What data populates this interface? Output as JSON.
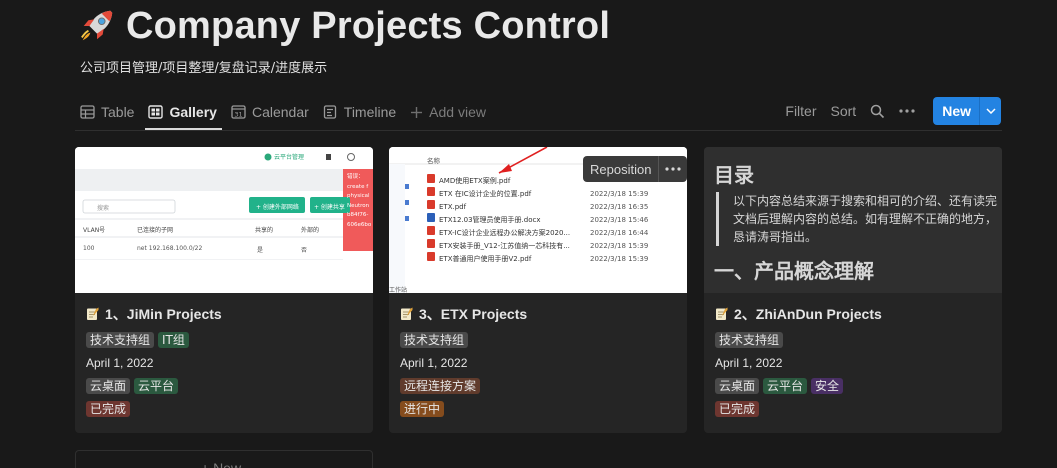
{
  "page": {
    "title": "Company Projects Control",
    "subtitle": "公司项目管理/项目整理/复盘记录/进度展示"
  },
  "tabs": [
    {
      "label": "Table",
      "icon": "table-icon"
    },
    {
      "label": "Gallery",
      "icon": "gallery-icon",
      "active": true
    },
    {
      "label": "Calendar",
      "icon": "calendar-icon"
    },
    {
      "label": "Timeline",
      "icon": "timeline-icon"
    },
    {
      "label": "Add view",
      "icon": "plus-icon"
    }
  ],
  "toolbar": {
    "filter_label": "Filter",
    "sort_label": "Sort",
    "new_label": "New"
  },
  "colors": {
    "background": "#191919",
    "card": "#252525",
    "accent": "#2383e2"
  },
  "cover_tools": {
    "reposition_label": "Reposition"
  },
  "cards": [
    {
      "title": "1、JiMin Projects",
      "groups": [
        {
          "text": "技术支持组",
          "color": "gray"
        },
        {
          "text": "IT组",
          "color": "green"
        }
      ],
      "date": "April 1, 2022",
      "products": [
        {
          "text": "云桌面",
          "color": "gray"
        },
        {
          "text": "云平台",
          "color": "green"
        }
      ],
      "status": {
        "text": "已完成",
        "color": "brown"
      },
      "cover": {
        "header_label": "云平台管理",
        "search_placeholder": "搜索",
        "btn1": "+ 创建外部网络",
        "btn2": "+ 创建共享",
        "columns": [
          "VLAN号",
          "已连接的子网",
          "共享的",
          "外部的"
        ],
        "row": [
          "100",
          "net 192.168.100.0/22",
          "是",
          "否"
        ],
        "error_lines": [
          "错误：",
          "create f",
          "physical",
          "Neutron",
          "b84f76-",
          "606e6bo"
        ]
      }
    },
    {
      "title": "3、ETX Projects",
      "groups": [
        {
          "text": "技术支持组",
          "color": "gray"
        }
      ],
      "date": "April 1, 2022",
      "products": [
        {
          "text": "远程连接方案",
          "color": "brown"
        }
      ],
      "status": {
        "text": "进行中",
        "color": "orange"
      },
      "cover": {
        "header": "名称",
        "files": [
          {
            "name": "AMD使用ETX案例.pdf",
            "date": ""
          },
          {
            "name": "ETX 在IC设计企业的位置.pdf",
            "date": "2022/3/18 15:39"
          },
          {
            "name": "ETX.pdf",
            "date": "2022/3/18 16:35"
          },
          {
            "name": "ETX12.03管理员使用手册.docx",
            "date": "2022/3/18 15:46"
          },
          {
            "name": "ETX-IC设计企业远程办公解决方案2020...",
            "date": "2022/3/18 16:44"
          },
          {
            "name": "ETX安装手册_V12-江苏值纳一芯科技有...",
            "date": "2022/3/18 15:39"
          },
          {
            "name": "ETX普通用户使用手册V2.pdf",
            "date": "2022/3/18 15:39"
          }
        ],
        "side_text": "工作站"
      }
    },
    {
      "title": "2、ZhiAnDun Projects",
      "groups": [
        {
          "text": "技术支持组",
          "color": "gray"
        }
      ],
      "date": "April 1, 2022",
      "products": [
        {
          "text": "云桌面",
          "color": "gray"
        },
        {
          "text": "云平台",
          "color": "green"
        },
        {
          "text": "安全",
          "color": "purple"
        }
      ],
      "status": {
        "text": "已完成",
        "color": "brown"
      },
      "cover": {
        "heading": "目录",
        "quote": "以下内容总结来源于搜索和相可的介绍、还有读完文档后理解内容的总结。如有理解不正确的地方，恳请涛哥指出。",
        "section": "一、产品概念理解"
      }
    }
  ],
  "bottom_card_label": "+ New"
}
